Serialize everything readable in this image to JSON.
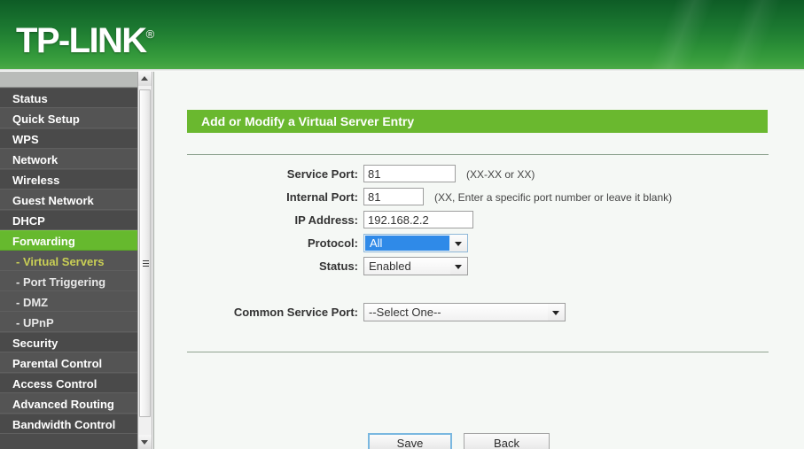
{
  "brand": {
    "name": "TP-LINK",
    "trademark": "®"
  },
  "sidebar": {
    "items": [
      {
        "label": "Status",
        "type": "top",
        "state": "normal"
      },
      {
        "label": "Quick Setup",
        "type": "top",
        "state": "normal"
      },
      {
        "label": "WPS",
        "type": "top",
        "state": "normal"
      },
      {
        "label": "Network",
        "type": "top",
        "state": "normal"
      },
      {
        "label": "Wireless",
        "type": "top",
        "state": "normal"
      },
      {
        "label": "Guest Network",
        "type": "top",
        "state": "normal"
      },
      {
        "label": "DHCP",
        "type": "top",
        "state": "normal"
      },
      {
        "label": "Forwarding",
        "type": "top",
        "state": "active"
      },
      {
        "label": "- Virtual Servers",
        "type": "sub",
        "state": "active-sub"
      },
      {
        "label": "- Port Triggering",
        "type": "sub",
        "state": "normal"
      },
      {
        "label": "- DMZ",
        "type": "sub",
        "state": "normal"
      },
      {
        "label": "- UPnP",
        "type": "sub",
        "state": "normal"
      },
      {
        "label": "Security",
        "type": "top",
        "state": "normal"
      },
      {
        "label": "Parental Control",
        "type": "top",
        "state": "normal"
      },
      {
        "label": "Access Control",
        "type": "top",
        "state": "normal"
      },
      {
        "label": "Advanced Routing",
        "type": "top",
        "state": "normal"
      },
      {
        "label": "Bandwidth Control",
        "type": "top",
        "state": "normal"
      }
    ]
  },
  "panel": {
    "title": "Add or Modify a Virtual Server Entry"
  },
  "form": {
    "service_port": {
      "label": "Service Port:",
      "value": "81",
      "hint": "(XX-XX or XX)"
    },
    "internal_port": {
      "label": "Internal Port:",
      "value": "81",
      "hint": "(XX, Enter a specific port number or leave it blank)"
    },
    "ip_address": {
      "label": "IP Address:",
      "value": "192.168.2.2"
    },
    "protocol": {
      "label": "Protocol:",
      "value": "All"
    },
    "status": {
      "label": "Status:",
      "value": "Enabled"
    },
    "common_service_port": {
      "label": "Common Service Port:",
      "value": "--Select One--"
    }
  },
  "buttons": {
    "save": "Save",
    "back": "Back"
  },
  "colors": {
    "header_green_dark": "#0e5c26",
    "header_green_light": "#4caa46",
    "panel_green": "#6ab82f",
    "active_menu_green": "#66b92e",
    "sub_active_yellow": "#c9cf55",
    "select_highlight_blue": "#2f8ae8",
    "focus_ring_blue": "#7ab8e0"
  }
}
